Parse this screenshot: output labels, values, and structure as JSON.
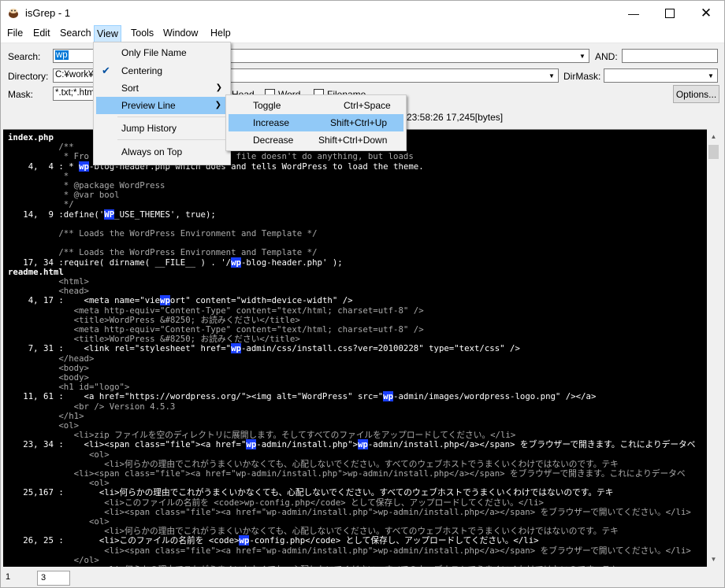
{
  "window": {
    "title": "isGrep - 1"
  },
  "menubar": {
    "items": [
      "File",
      "Edit",
      "Search",
      "View",
      "Tools",
      "Window",
      "Help"
    ]
  },
  "form": {
    "search_label": "Search:",
    "search_value": "wp",
    "and_label": "AND:",
    "directory_label": "Directory:",
    "directory_value": "C:¥work¥",
    "dirmask_label": "DirMask:",
    "mask_label": "Mask:",
    "mask_value": "*.txt;*.htm",
    "checkboxes": [
      "Head",
      "Word",
      "Filename"
    ],
    "options_label": "Options...",
    "info_text": "23:58:26 17,245[bytes]"
  },
  "view_menu": {
    "items": [
      "Only File Name",
      "Centering",
      "Sort",
      "Preview Line",
      "Jump History",
      "Always on Top"
    ],
    "checked": "Centering"
  },
  "preview_submenu": {
    "items": [
      {
        "label": "Toggle",
        "shortcut": "Ctrl+Space"
      },
      {
        "label": "Increase",
        "shortcut": "Shift+Ctrl+Up"
      },
      {
        "label": "Decrease",
        "shortcut": "Shift+Ctrl+Down"
      }
    ]
  },
  "results": {
    "lines": [
      {
        "kind": "file",
        "text": "index.php"
      },
      {
        "kind": "ctx",
        "text": "          /**"
      },
      {
        "kind": "ctx",
        "text": "           * Fro                    on. This file doesn't do anything, but loads"
      },
      {
        "kind": "match",
        "pre": "    4,  4 : * ",
        "hl": "wp",
        "post": "-blog-header.php which does and tells WordPress to load the theme."
      },
      {
        "kind": "ctx",
        "text": "           *"
      },
      {
        "kind": "ctx",
        "text": "           * @package WordPress"
      },
      {
        "kind": "ctx",
        "text": "           * @var bool"
      },
      {
        "kind": "ctx",
        "text": "           */"
      },
      {
        "kind": "match",
        "pre": "   14,  9 :define('",
        "hl": "WP",
        "post": "_USE_THEMES', true);"
      },
      {
        "kind": "ctx",
        "text": ""
      },
      {
        "kind": "ctx",
        "text": "          /** Loads the WordPress Environment and Template */"
      },
      {
        "kind": "ctx",
        "text": ""
      },
      {
        "kind": "ctx",
        "text": "          /** Loads the WordPress Environment and Template */"
      },
      {
        "kind": "match",
        "pre": "   17, 34 :require( dirname( __FILE__ ) . '/",
        "hl": "wp",
        "post": "-blog-header.php' );"
      },
      {
        "kind": "file",
        "text": "readme.html"
      },
      {
        "kind": "ctx",
        "text": "          <html>"
      },
      {
        "kind": "ctx",
        "text": "          <head>"
      },
      {
        "kind": "match",
        "pre": "    4, 17 :    <meta name=\"vie",
        "hl": "wp",
        "post": "ort\" content=\"width=device-width\" />"
      },
      {
        "kind": "ctx",
        "text": "             <meta http-equiv=\"Content-Type\" content=\"text/html; charset=utf-8\" />"
      },
      {
        "kind": "ctx",
        "text": "             <title>WordPress &#8250; お読みください</title>"
      },
      {
        "kind": "ctx",
        "text": "             <meta http-equiv=\"Content-Type\" content=\"text/html; charset=utf-8\" />"
      },
      {
        "kind": "ctx",
        "text": "             <title>WordPress &#8250; お読みください</title>"
      },
      {
        "kind": "match",
        "pre": "    7, 31 :    <link rel=\"stylesheet\" href=\"",
        "hl": "wp",
        "post": "-admin/css/install.css?ver=20100228\" type=\"text/css\" />"
      },
      {
        "kind": "ctx",
        "text": "          </head>"
      },
      {
        "kind": "ctx",
        "text": "          <body>"
      },
      {
        "kind": "ctx",
        "text": "          <body>"
      },
      {
        "kind": "ctx",
        "text": "          <h1 id=\"logo\">"
      },
      {
        "kind": "match",
        "pre": "   11, 61 :    <a href=\"https://wordpress.org/\"><img alt=\"WordPress\" src=\"",
        "hl": "wp",
        "post": "-admin/images/wordpress-logo.png\" /></a>"
      },
      {
        "kind": "ctx",
        "text": "             <br /> Version 4.5.3"
      },
      {
        "kind": "ctx",
        "text": "          </h1>"
      },
      {
        "kind": "ctx",
        "text": "          <ol>"
      },
      {
        "kind": "ctx",
        "text": "             <li>zip ファイルを空のディレクトリに展開します。そしてすべてのファイルをアップロードしてください。</li>"
      },
      {
        "kind": "match2",
        "pre": "   23, 34 :    <li><span class=\"file\"><a href=\"",
        "hl": "wp",
        "mid": "-admin/install.php\">",
        "hl2": "wp",
        "post": "-admin/install.php</a></span> をブラウザーで開きます。これによりデータベ"
      },
      {
        "kind": "ctx",
        "text": "                <ol>"
      },
      {
        "kind": "ctx",
        "text": "                   <li>何らかの理由でこれがうまくいかなくても、心配しないでください。すべてのウェブホストでうまくいくわけではないのです。テキ"
      },
      {
        "kind": "ctx",
        "text": "             <li><span class=\"file\"><a href=\"wp-admin/install.php\">wp-admin/install.php</a></span> をブラウザーで開きます。これによりデータベ"
      },
      {
        "kind": "ctx",
        "text": "                <ol>"
      },
      {
        "kind": "match",
        "pre": "   25,167 :       <li>何らかの理由でこれがうまくいかなくても、心配しないでください。すべてのウェブホストでうまくいくわけではないのです。テキ",
        "hl": "",
        "post": ""
      },
      {
        "kind": "ctx",
        "text": "                   <li>このファイルの名前を <code>wp-config.php</code> として保存し、アップロードしてください。</li>"
      },
      {
        "kind": "ctx",
        "text": "                   <li><span class=\"file\"><a href=\"wp-admin/install.php\">wp-admin/install.php</a></span> をブラウザーで開いてください。</li>"
      },
      {
        "kind": "ctx",
        "text": "                <ol>"
      },
      {
        "kind": "ctx",
        "text": "                   <li>何らかの理由でこれがうまくいかなくても、心配しないでください。すべてのウェブホストでうまくいくわけではないのです。テキ"
      },
      {
        "kind": "match",
        "pre": "   26, 25 :       <li>このファイルの名前を <code>",
        "hl": "wp",
        "post": "-config.php</code> として保存し、アップロードしてください。</li>"
      },
      {
        "kind": "ctx",
        "text": "                   <li><span class=\"file\"><a href=\"wp-admin/install.php\">wp-admin/install.php</a></span> をブラウザーで開いてください。</li>"
      },
      {
        "kind": "ctx",
        "text": "             </ol>"
      },
      {
        "kind": "ctx",
        "text": "                   <li>何らかの理由でこれがうまくいかなくても、心配しないでください。すべてのウェブホストでうまくいくわけではないのです。テキ"
      }
    ]
  },
  "statusbar": {
    "cells": [
      "1",
      "3"
    ]
  },
  "colors": {
    "highlight": "#1a3fff",
    "menu_hover": "#91c9f7",
    "result_bg": "#000000"
  }
}
